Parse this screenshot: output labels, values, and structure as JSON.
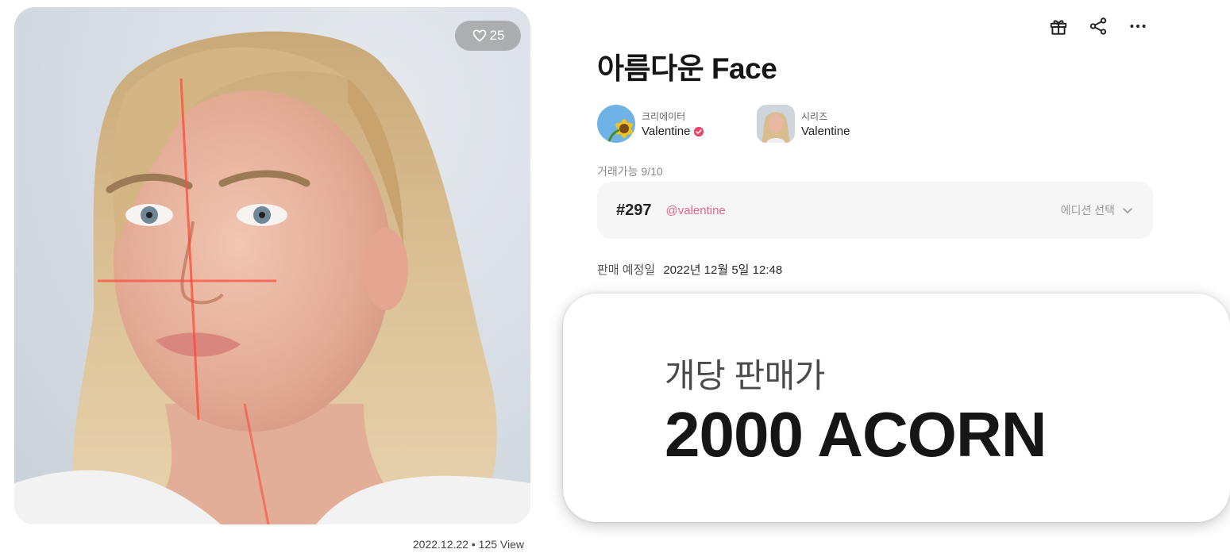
{
  "artwork": {
    "like_count": "25",
    "date": "2022.12.22",
    "separator": "•",
    "views": "125 View"
  },
  "actions": {
    "icons": [
      "gift-icon",
      "share-icon",
      "more-icon"
    ]
  },
  "title": "아름다운 Face",
  "creator": {
    "role": "크리에이터",
    "name": "Valentine"
  },
  "series": {
    "role": "시리즈",
    "name": "Valentine"
  },
  "tradeable": "거래가능 9/10",
  "edition": {
    "number": "#297",
    "owner": "@valentine",
    "select_label": "에디션 선택"
  },
  "sale": {
    "label": "판매 예정일",
    "date": "2022년 12월 5일 12:48"
  },
  "price": {
    "label": "개당 판매가",
    "value": "2000 ACORN"
  },
  "colors": {
    "accent_pink": "#e8668b",
    "verified_pink": "#e8456f",
    "panel_bg": "#f6f6f7"
  }
}
